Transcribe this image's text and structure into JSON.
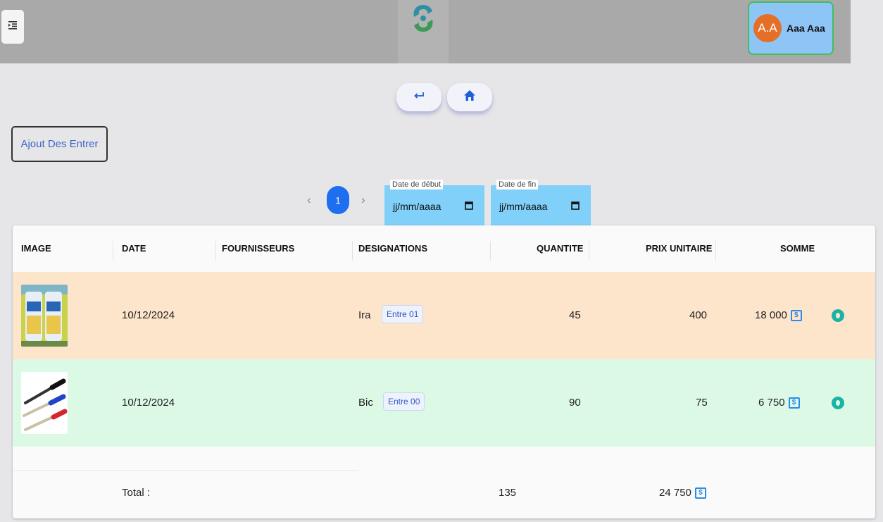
{
  "header": {
    "menu_icon": "indent-menu-icon",
    "logo_icon": "app-logo-icon",
    "user": {
      "initials": "A.A",
      "name": "Aaa Aaa"
    }
  },
  "nav": {
    "back_icon": "return-arrow-icon",
    "home_icon": "home-icon"
  },
  "actions": {
    "add_entry_label": "Ajout Des Entrer"
  },
  "pagination": {
    "current_page": "1",
    "prev_icon": "chevron-left-icon",
    "next_icon": "chevron-right-icon"
  },
  "filters": {
    "start_date": {
      "label": "Date de début",
      "value": "jj/mm/aaaa"
    },
    "end_date": {
      "label": "Date de fin",
      "value": "jj/mm/aaaa"
    }
  },
  "table": {
    "columns": [
      "IMAGE",
      "DATE",
      "FOURNISSEURS",
      "DESIGNATIONS",
      "QUANTITE",
      "PRIX UNITAIRE",
      "SOMME"
    ],
    "rows": [
      {
        "image": "drink-cans-photo",
        "date": "10/12/2024",
        "supplier": "",
        "designation": "Ira",
        "entry_badge": "Entre 01",
        "quantity": "45",
        "unit_price": "400",
        "sum": "18 000",
        "row_color": "#fde5cc"
      },
      {
        "image": "pens-photo",
        "date": "10/12/2024",
        "supplier": "",
        "designation": "Bic",
        "entry_badge": "Entre 00",
        "quantity": "90",
        "unit_price": "75",
        "sum": "6 750",
        "row_color": "#dcf9e6"
      }
    ],
    "totals": {
      "label": "Total :",
      "quantity": "135",
      "sum": "24 750"
    },
    "currency_icon": "dollar-bill-icon",
    "view_icon": "view-eye-icon"
  },
  "colors": {
    "accent": "#1e6ff0",
    "row_orange": "#fde5cc",
    "row_green": "#dcf9e6",
    "date_field": "#80d0fa",
    "avatar": "#e66f28",
    "teal": "#1ab3a6"
  }
}
